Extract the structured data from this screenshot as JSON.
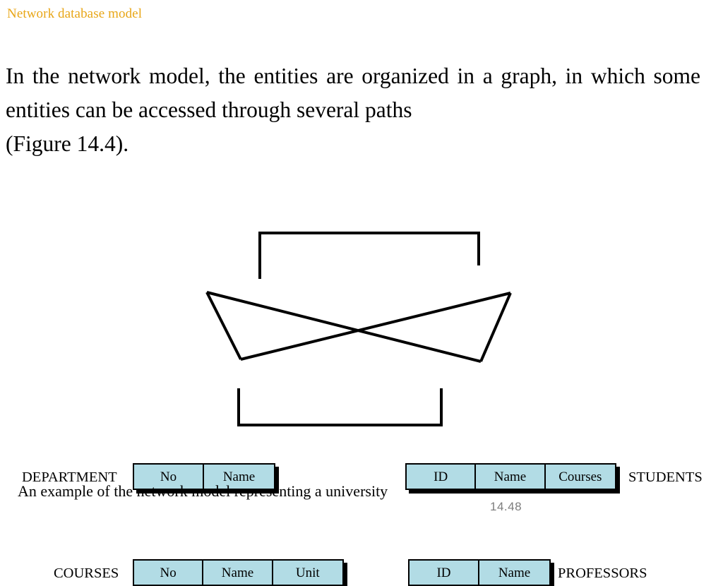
{
  "slide": {
    "title": "Network database model",
    "title_color": "#e8a617",
    "page_number": "14.48"
  },
  "body": {
    "paragraph_line1": "In the network model, the entities are organized in a graph,",
    "paragraph_line2": "in which some entities can be accessed through several paths",
    "paragraph_line3": "(Figure 14.4)."
  },
  "figure": {
    "caption": "An example of the network model representing a university",
    "box_fill_color": "#b2dce5",
    "border_color": "#000000",
    "entities": [
      {
        "id": "department",
        "label": "DEPARTMENT",
        "label_side": "left",
        "fields": [
          "No",
          "Name"
        ]
      },
      {
        "id": "students",
        "label": "STUDENTS",
        "label_side": "right",
        "fields": [
          "ID",
          "Name",
          "Courses"
        ]
      },
      {
        "id": "courses",
        "label": "COURSES",
        "label_side": "left",
        "fields": [
          "No",
          "Name",
          "Unit"
        ]
      },
      {
        "id": "professors",
        "label": "PROFESSORS",
        "label_side": "right",
        "fields": [
          "ID",
          "Name"
        ]
      }
    ],
    "links": [
      {
        "from": "department",
        "to": "students",
        "style": "top-bracket"
      },
      {
        "from": "courses",
        "to": "professors",
        "style": "bottom-bracket"
      },
      {
        "from": "department",
        "to": "courses",
        "style": "diagonal"
      },
      {
        "from": "department",
        "to": "professors",
        "style": "diagonal"
      },
      {
        "from": "students",
        "to": "courses",
        "style": "diagonal"
      },
      {
        "from": "students",
        "to": "professors",
        "style": "diagonal"
      }
    ]
  }
}
